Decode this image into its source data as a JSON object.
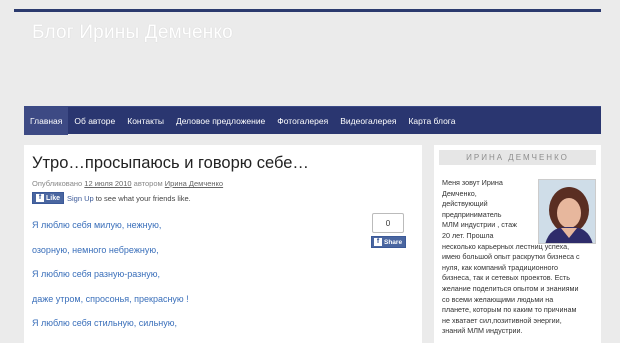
{
  "site": {
    "title": "Блог Ирины Демченко"
  },
  "nav": {
    "items": [
      "Главная",
      "Об авторе",
      "Контакты",
      "Деловое предложение",
      "Фотогалерея",
      "Видеогалерея",
      "Карта блога"
    ]
  },
  "post": {
    "title": "Утро…просыпаюсь и говорю себе…",
    "meta_prefix": "Опубликовано",
    "date": "12 июля 2010",
    "author_prefix": "автором",
    "author": "Ирина Демченко",
    "lines": [
      "Я люблю себя милую, нежную,",
      "озорную, немного небрежную,",
      "Я люблю себя разную-разную,",
      "даже утром, спросонья, прекрасную !",
      "Я люблю себя стильную, сильную,"
    ]
  },
  "facebook": {
    "like_label": "Like",
    "signup": "Sign Up",
    "friends_text": "to see what your friends like.",
    "share_count": "0",
    "share_label": "Share"
  },
  "sidebar": {
    "heading": "ИРИНА ДЕМЧЕНКО",
    "lines": [
      "Меня зовут Ирина",
      "Демченко,",
      "действующий",
      "предприниматель",
      "МЛМ индустрии , стаж",
      "20 лет. Прошла",
      "несколько карьерных лестниц успеха,",
      "имею большой опыт раскрутки бизнеса с",
      "нуля, как компаний традиционного",
      "бизнеса, так и сетевых проектов. Есть",
      "желание поделиться опытом и знаниями",
      "со всеми желающими людьми на",
      "планете, которым по каким то причинам",
      "не хватает сил,позитивной энергии,",
      "знаний МЛМ индустрии."
    ]
  },
  "colors": {
    "nav_bg": "#2a3670",
    "link": "#3a6fba",
    "fb": "#3b5998"
  }
}
